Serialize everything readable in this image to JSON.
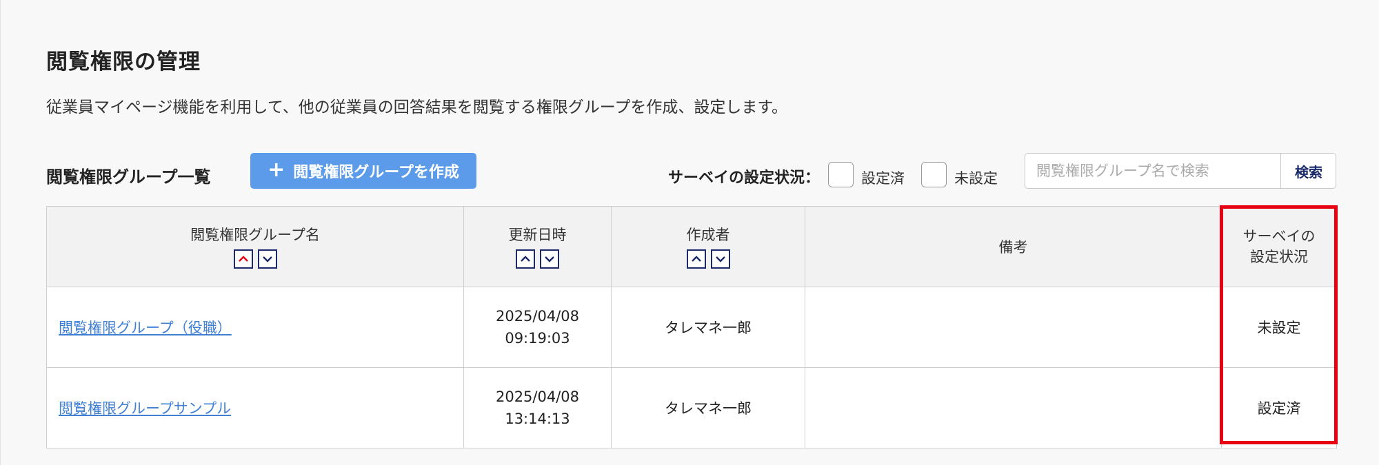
{
  "page": {
    "title": "閲覧権限の管理",
    "description": "従業員マイページ機能を利用して、他の従業員の回答結果を閲覧する権限グループを作成、設定します。"
  },
  "toolbar": {
    "section_title": "閲覧権限グループ一覧",
    "create_button_label": "閲覧権限グループを作成",
    "create_button_icon": "plus-icon",
    "filter_label": "サーベイの設定状況：",
    "filters": [
      {
        "label": "設定済",
        "checked": false
      },
      {
        "label": "未設定",
        "checked": false
      }
    ],
    "search_placeholder": "閲覧権限グループ名で検索",
    "search_value": "",
    "search_button_label": "検索"
  },
  "table": {
    "columns": {
      "name": "閲覧権限グループ名",
      "updated": "更新日時",
      "creator": "作成者",
      "notes": "備考",
      "survey_line1": "サーベイの",
      "survey_line2": "設定状況"
    },
    "sort_icons": [
      "sort-ascending-icon",
      "sort-descending-icon"
    ],
    "rows": [
      {
        "name": "閲覧権限グループ（役職）",
        "date": "2025/04/08",
        "time": "09:19:03",
        "creator": "タレマネ一郎",
        "notes": "",
        "survey_status": "未設定"
      },
      {
        "name": "閲覧権限グループサンプル",
        "date": "2025/04/08",
        "time": "13:14:13",
        "creator": "タレマネ一郎",
        "notes": "",
        "survey_status": "設定済"
      }
    ]
  },
  "colors": {
    "background": "#f8f8f8",
    "primary_button": "#5b9bea",
    "link": "#3f7fd4",
    "sort_border": "#1b2a6b",
    "active_sort_arrow": "#e60012",
    "highlight_border": "#e60012",
    "header_background": "#f2f2f2"
  }
}
